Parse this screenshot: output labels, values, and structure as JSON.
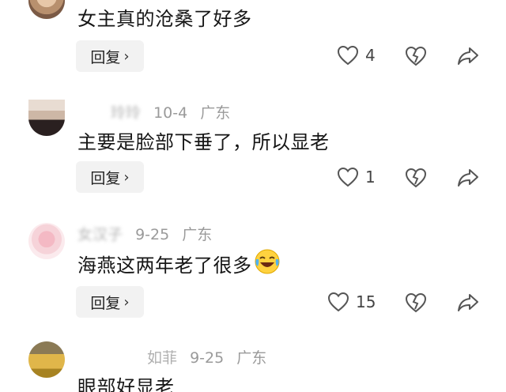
{
  "comments": [
    {
      "id": "c0",
      "name": "",
      "date": "",
      "location": "",
      "text": "女主真的沧桑了好多",
      "reply_label": "回复",
      "likes": "4",
      "avatar_color": "#d7b79a"
    },
    {
      "id": "c1",
      "name": "玲玲",
      "date": "10-4",
      "location": "广东",
      "text": "主要是脸部下垂了，所以显老",
      "reply_label": "回复",
      "likes": "1",
      "avatar_color": "#c9b3a8"
    },
    {
      "id": "c2",
      "name": "女汉子",
      "date": "9-25",
      "location": "广东",
      "text": "海燕这两年老了很多",
      "reply_label": "回复",
      "likes": "15",
      "avatar_color": "#efc7cf",
      "emoji": "laughing-crying-emoji"
    },
    {
      "id": "c3",
      "name": "如菲",
      "date": "9-25",
      "location": "广东",
      "text": "眼部好显老",
      "reply_label": "",
      "likes": "",
      "avatar_color": "#c9a94a"
    }
  ]
}
